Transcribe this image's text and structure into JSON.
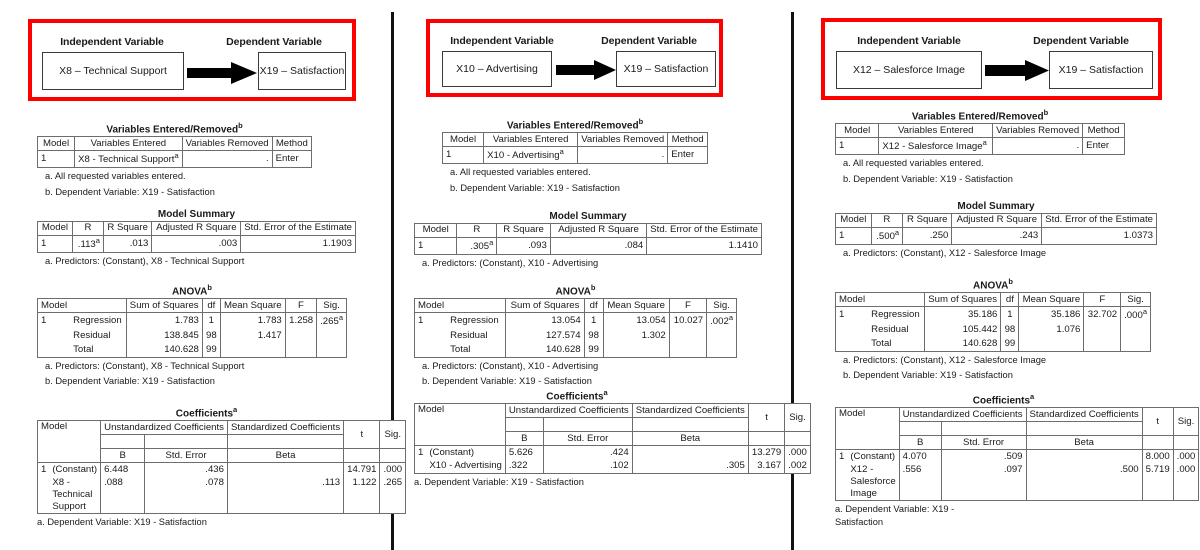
{
  "document": {
    "type": "spss-regression-output-sheet",
    "panel_count": 3,
    "accent_color": "#fe0000",
    "divider_color": "#111111"
  },
  "panels": [
    {
      "id": "panel-1",
      "diagram": {
        "independent_label": "Independent Variable",
        "dependent_label": "Dependent Variable",
        "independent_var": "X8 – Technical Support",
        "dependent_var": "X19 – Satisfaction",
        "arrow": "right-arrow-icon"
      },
      "variables_entered": {
        "title": "Variables Entered/Removed",
        "title_sup": "b",
        "headers": [
          "Model",
          "Variables Entered",
          "Variables Removed",
          "Method"
        ],
        "row": {
          "model": "1",
          "entered": "X8 - Technical Support",
          "entered_sup": "a",
          "removed": ".",
          "method": "Enter"
        },
        "notes": [
          "a. All requested variables entered.",
          "b. Dependent Variable: X19 - Satisfaction"
        ]
      },
      "model_summary": {
        "title": "Model Summary",
        "headers": [
          "Model",
          "R",
          "R Square",
          "Adjusted R Square",
          "Std. Error of the Estimate"
        ],
        "row": {
          "model": "1",
          "r": ".113",
          "r_sup": "a",
          "r_square": ".013",
          "adj_r_square": ".003",
          "std_error": "1.1903"
        },
        "notes": [
          "a. Predictors: (Constant), X8 - Technical Support"
        ]
      },
      "anova": {
        "title": "ANOVA",
        "title_sup": "b",
        "headers": [
          "Model",
          "Sum of Squares",
          "df",
          "Mean Square",
          "F",
          "Sig."
        ],
        "rows": [
          {
            "model": "1",
            "source": "Regression",
            "ss": "1.783",
            "df": "1",
            "ms": "1.783",
            "f": "1.258",
            "sig": ".265",
            "sig_sup": "a"
          },
          {
            "model": "",
            "source": "Residual",
            "ss": "138.845",
            "df": "98",
            "ms": "1.417",
            "f": "",
            "sig": "",
            "sig_sup": ""
          },
          {
            "model": "",
            "source": "Total",
            "ss": "140.628",
            "df": "99",
            "ms": "",
            "f": "",
            "sig": "",
            "sig_sup": ""
          }
        ],
        "notes": [
          "a. Predictors: (Constant), X8 - Technical Support",
          "b. Dependent Variable: X19 - Satisfaction"
        ]
      },
      "coefficients": {
        "title": "Coefficients",
        "title_sup": "a",
        "header_model": "Model",
        "header_unstd": "Unstandardized Coefficients",
        "header_std": "Standardized Coefficients",
        "header_t": "t",
        "header_sig": "Sig.",
        "sub_b": "B",
        "sub_se": "Std. Error",
        "sub_beta": "Beta",
        "rows": [
          {
            "model": "1",
            "name": "(Constant)",
            "b": "6.448",
            "se": ".436",
            "beta": "",
            "t": "14.791",
            "sig": ".000"
          },
          {
            "model": "",
            "name": "X8 - Technical Support",
            "b": ".088",
            "se": ".078",
            "beta": ".113",
            "t": "1.122",
            "sig": ".265"
          }
        ],
        "notes": [
          "a. Dependent Variable: X19 - Satisfaction"
        ]
      }
    },
    {
      "id": "panel-2",
      "diagram": {
        "independent_label": "Independent Variable",
        "dependent_label": "Dependent Variable",
        "independent_var": "X10 – Advertising",
        "dependent_var": "X19 – Satisfaction",
        "arrow": "right-arrow-icon"
      },
      "variables_entered": {
        "title": "Variables Entered/Removed",
        "title_sup": "b",
        "headers": [
          "Model",
          "Variables Entered",
          "Variables Removed",
          "Method"
        ],
        "row": {
          "model": "1",
          "entered": "X10 - Advertising",
          "entered_sup": "a",
          "removed": ".",
          "method": "Enter"
        },
        "notes": [
          "a. All requested variables entered.",
          "b. Dependent Variable: X19 - Satisfaction"
        ]
      },
      "model_summary": {
        "title": "Model Summary",
        "headers": [
          "Model",
          "R",
          "R Square",
          "Adjusted R Square",
          "Std. Error of the Estimate"
        ],
        "row": {
          "model": "1",
          "r": ".305",
          "r_sup": "a",
          "r_square": ".093",
          "adj_r_square": ".084",
          "std_error": "1.1410"
        },
        "notes": [
          "a. Predictors: (Constant), X10 - Advertising"
        ]
      },
      "anova": {
        "title": "ANOVA",
        "title_sup": "b",
        "headers": [
          "Model",
          "Sum of Squares",
          "df",
          "Mean Square",
          "F",
          "Sig."
        ],
        "rows": [
          {
            "model": "1",
            "source": "Regression",
            "ss": "13.054",
            "df": "1",
            "ms": "13.054",
            "f": "10.027",
            "sig": ".002",
            "sig_sup": "a"
          },
          {
            "model": "",
            "source": "Residual",
            "ss": "127.574",
            "df": "98",
            "ms": "1.302",
            "f": "",
            "sig": "",
            "sig_sup": ""
          },
          {
            "model": "",
            "source": "Total",
            "ss": "140.628",
            "df": "99",
            "ms": "",
            "f": "",
            "sig": "",
            "sig_sup": ""
          }
        ],
        "notes": [
          "a. Predictors: (Constant), X10 - Advertising",
          "b. Dependent Variable: X19 - Satisfaction"
        ]
      },
      "coefficients": {
        "title": "Coefficients",
        "title_sup": "a",
        "header_model": "Model",
        "header_unstd": "Unstandardized Coefficients",
        "header_std": "Standardized Coefficients",
        "header_t": "t",
        "header_sig": "Sig.",
        "sub_b": "B",
        "sub_se": "Std. Error",
        "sub_beta": "Beta",
        "rows": [
          {
            "model": "1",
            "name": "(Constant)",
            "b": "5.626",
            "se": ".424",
            "beta": "",
            "t": "13.279",
            "sig": ".000"
          },
          {
            "model": "",
            "name": "X10 - Advertising",
            "b": ".322",
            "se": ".102",
            "beta": ".305",
            "t": "3.167",
            "sig": ".002"
          }
        ],
        "notes": [
          "a. Dependent Variable: X19 - Satisfaction"
        ]
      }
    },
    {
      "id": "panel-3",
      "diagram": {
        "independent_label": "Independent Variable",
        "dependent_label": "Dependent Variable",
        "independent_var": "X12 – Salesforce Image",
        "dependent_var": "X19 – Satisfaction",
        "arrow": "right-arrow-icon"
      },
      "variables_entered": {
        "title": "Variables Entered/Removed",
        "title_sup": "b",
        "headers": [
          "Model",
          "Variables Entered",
          "Variables Removed",
          "Method"
        ],
        "row": {
          "model": "1",
          "entered": "X12 - Salesforce Image",
          "entered_sup": "a",
          "removed": ".",
          "method": "Enter"
        },
        "notes": [
          "a. All requested variables entered.",
          "b. Dependent Variable: X19 - Satisfaction"
        ]
      },
      "model_summary": {
        "title": "Model Summary",
        "headers": [
          "Model",
          "R",
          "R Square",
          "Adjusted R Square",
          "Std. Error of the Estimate"
        ],
        "row": {
          "model": "1",
          "r": ".500",
          "r_sup": "a",
          "r_square": ".250",
          "adj_r_square": ".243",
          "std_error": "1.0373"
        },
        "notes": [
          "a. Predictors: (Constant), X12 - Salesforce Image"
        ]
      },
      "anova": {
        "title": "ANOVA",
        "title_sup": "b",
        "headers": [
          "Model",
          "Sum of Squares",
          "df",
          "Mean Square",
          "F",
          "Sig."
        ],
        "rows": [
          {
            "model": "1",
            "source": "Regression",
            "ss": "35.186",
            "df": "1",
            "ms": "35.186",
            "f": "32.702",
            "sig": ".000",
            "sig_sup": "a"
          },
          {
            "model": "",
            "source": "Residual",
            "ss": "105.442",
            "df": "98",
            "ms": "1.076",
            "f": "",
            "sig": "",
            "sig_sup": ""
          },
          {
            "model": "",
            "source": "Total",
            "ss": "140.628",
            "df": "99",
            "ms": "",
            "f": "",
            "sig": "",
            "sig_sup": ""
          }
        ],
        "notes": [
          "a. Predictors: (Constant), X12 - Salesforce Image",
          "b. Dependent Variable: X19 - Satisfaction"
        ]
      },
      "coefficients": {
        "title": "Coefficients",
        "title_sup": "a",
        "header_model": "Model",
        "header_unstd": "Unstandardized Coefficients",
        "header_std": "Standardized Coefficients",
        "header_t": "t",
        "header_sig": "Sig.",
        "sub_b": "B",
        "sub_se": "Std. Error",
        "sub_beta": "Beta",
        "rows": [
          {
            "model": "1",
            "name": "(Constant)",
            "b": "4.070",
            "se": ".509",
            "beta": "",
            "t": "8.000",
            "sig": ".000"
          },
          {
            "model": "",
            "name": "X12 - Salesforce Image",
            "b": ".556",
            "se": ".097",
            "beta": ".500",
            "t": "5.719",
            "sig": ".000"
          }
        ],
        "notes": [
          "a. Dependent Variable: X19 - Satisfaction"
        ]
      }
    }
  ]
}
